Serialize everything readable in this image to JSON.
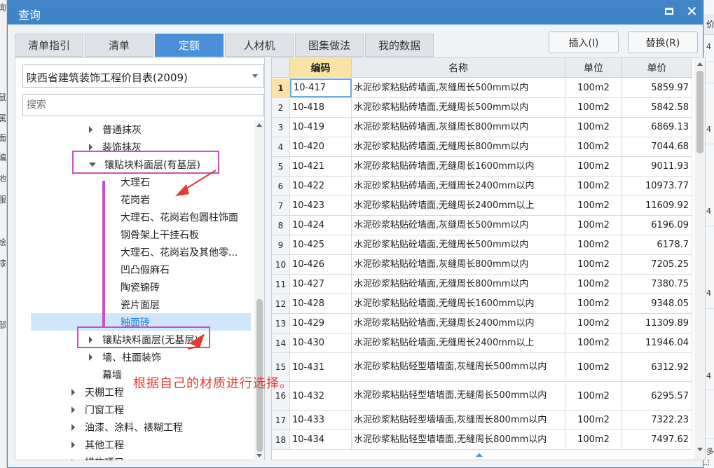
{
  "dialog": {
    "title": "查询"
  },
  "tabs": [
    {
      "label": "清单指引",
      "active": false
    },
    {
      "label": "清单",
      "active": false
    },
    {
      "label": "定额",
      "active": true
    },
    {
      "label": "人材机",
      "active": false
    },
    {
      "label": "图集做法",
      "active": false
    },
    {
      "label": "我的数据",
      "active": false
    }
  ],
  "buttons": {
    "insert": "插入(I)",
    "replace": "替换(R)"
  },
  "library": {
    "selected": "陕西省建筑装饰工程价目表(2009)"
  },
  "search": {
    "placeholder": "搜索"
  },
  "tree": [
    {
      "label": "普通抹灰",
      "level": 2,
      "expander": "collapsed"
    },
    {
      "label": "装饰抹灰",
      "level": 2,
      "expander": "collapsed"
    },
    {
      "label": "镶贴块料面层(有基层)",
      "level": 2,
      "expander": "expanded"
    },
    {
      "label": "大理石",
      "level": 3,
      "expander": "none"
    },
    {
      "label": "花岗岩",
      "level": 3,
      "expander": "none"
    },
    {
      "label": "大理石、花岗岩包圆柱饰面",
      "level": 3,
      "expander": "none"
    },
    {
      "label": "钢骨架上干挂石板",
      "level": 3,
      "expander": "none"
    },
    {
      "label": "大理石、花岗岩及其他零...",
      "level": 3,
      "expander": "none"
    },
    {
      "label": "凹凸假麻石",
      "level": 3,
      "expander": "none"
    },
    {
      "label": "陶瓷锦砖",
      "level": 3,
      "expander": "none"
    },
    {
      "label": "瓷片面层",
      "level": 3,
      "expander": "none"
    },
    {
      "label": "釉面砖",
      "level": 3,
      "expander": "none",
      "selected": true
    },
    {
      "label": "镶贴块料面层(无基层)",
      "level": 2,
      "expander": "collapsed"
    },
    {
      "label": "墙、柱面装饰",
      "level": 2,
      "expander": "collapsed"
    },
    {
      "label": "幕墙",
      "level": 2,
      "expander": "none"
    },
    {
      "label": "天棚工程",
      "level": 1,
      "expander": "collapsed"
    },
    {
      "label": "门窗工程",
      "level": 1,
      "expander": "collapsed"
    },
    {
      "label": "油漆、涂料、裱糊工程",
      "level": 1,
      "expander": "collapsed"
    },
    {
      "label": "其他工程",
      "level": 1,
      "expander": "collapsed"
    },
    {
      "label": "措施项目",
      "level": 1,
      "expander": "collapsed"
    }
  ],
  "annotation": {
    "note": "根据自己的材质进行选择。",
    "color": "#c94fc9",
    "note_color": "#e53935"
  },
  "grid": {
    "headers": {
      "code": "编码",
      "name": "名称",
      "unit": "单位",
      "price": "单价"
    },
    "rows": [
      {
        "n": "1",
        "code": "10-417",
        "name": "水泥砂浆粘贴砖墙面,灰缝周长500mm以内",
        "unit": "100m2",
        "price": "5859.97"
      },
      {
        "n": "2",
        "code": "10-418",
        "name": "水泥砂浆粘贴砖墙面,无缝周长500mm以内",
        "unit": "100m2",
        "price": "5842.58"
      },
      {
        "n": "3",
        "code": "10-419",
        "name": "水泥砂浆粘贴砖墙面,灰缝周长800mm以内",
        "unit": "100m2",
        "price": "6869.13"
      },
      {
        "n": "4",
        "code": "10-420",
        "name": "水泥砂浆粘贴砖墙面,无缝周长800mm以内",
        "unit": "100m2",
        "price": "7044.68"
      },
      {
        "n": "5",
        "code": "10-421",
        "name": "水泥砂浆粘贴砖墙面,无缝周长1600mm以内",
        "unit": "100m2",
        "price": "9011.93"
      },
      {
        "n": "6",
        "code": "10-422",
        "name": "水泥砂浆粘贴砖墙面,无缝周长2400mm以内",
        "unit": "100m2",
        "price": "10973.77"
      },
      {
        "n": "7",
        "code": "10-423",
        "name": "水泥砂浆粘贴砖墙面,无缝周长2400mm以上",
        "unit": "100m2",
        "price": "11609.92"
      },
      {
        "n": "8",
        "code": "10-424",
        "name": "水泥砂浆粘贴砼墙面,灰缝周长500mm以内",
        "unit": "100m2",
        "price": "6196.09"
      },
      {
        "n": "9",
        "code": "10-425",
        "name": "水泥砂浆粘贴砼墙面,无缝周长500mm以内",
        "unit": "100m2",
        "price": "6178.7"
      },
      {
        "n": "10",
        "code": "10-426",
        "name": "水泥砂浆粘贴砼墙面,灰缝周长800mm以内",
        "unit": "100m2",
        "price": "7205.25"
      },
      {
        "n": "11",
        "code": "10-427",
        "name": "水泥砂浆粘贴砼墙面,无缝周长800mm以内",
        "unit": "100m2",
        "price": "7380.75"
      },
      {
        "n": "12",
        "code": "10-428",
        "name": "水泥砂浆粘贴砼墙面,无缝周长1600mm以内",
        "unit": "100m2",
        "price": "9348.05"
      },
      {
        "n": "13",
        "code": "10-429",
        "name": "水泥砂浆粘贴砼墙面,无缝周长2400mm以内",
        "unit": "100m2",
        "price": "11309.89"
      },
      {
        "n": "14",
        "code": "10-430",
        "name": "水泥砂浆粘贴砼墙面,无缝周长2400mm以上",
        "unit": "100m2",
        "price": "11946.04"
      },
      {
        "n": "15",
        "code": "10-431",
        "name": "水泥砂浆粘贴轻型墙墙面,灰缝周长500mm以内",
        "unit": "100m2",
        "price": "6312.92"
      },
      {
        "n": "16",
        "code": "10-432",
        "name": "水泥砂浆粘贴轻型墙墙面,无缝周长500mm以内",
        "unit": "100m2",
        "price": "6295.57"
      },
      {
        "n": "17",
        "code": "10-433",
        "name": "水泥砂浆粘贴轻型墙墙面,灰缝周长800mm以内",
        "unit": "100m2",
        "price": "7322.23"
      },
      {
        "n": "18",
        "code": "10-434",
        "name": "水泥砂浆粘贴轻型墙墙面,无缝周长800mm以内",
        "unit": "100m2",
        "price": "7497.62"
      }
    ]
  },
  "background": {
    "left_chars": [
      "询",
      "鼠",
      "属",
      "面",
      "编",
      "地",
      "服",
      "绘",
      "漆",
      "部"
    ],
    "right_header": "价",
    "right_cells": [
      "4",
      "4",
      "4",
      "4",
      "4",
      "多"
    ]
  },
  "colors": {
    "title_bar": "#3f85c8",
    "active_tab": "#4a90d9",
    "selected_header": "#fbe3a8",
    "tree_selected_text": "#1f7bd8"
  }
}
